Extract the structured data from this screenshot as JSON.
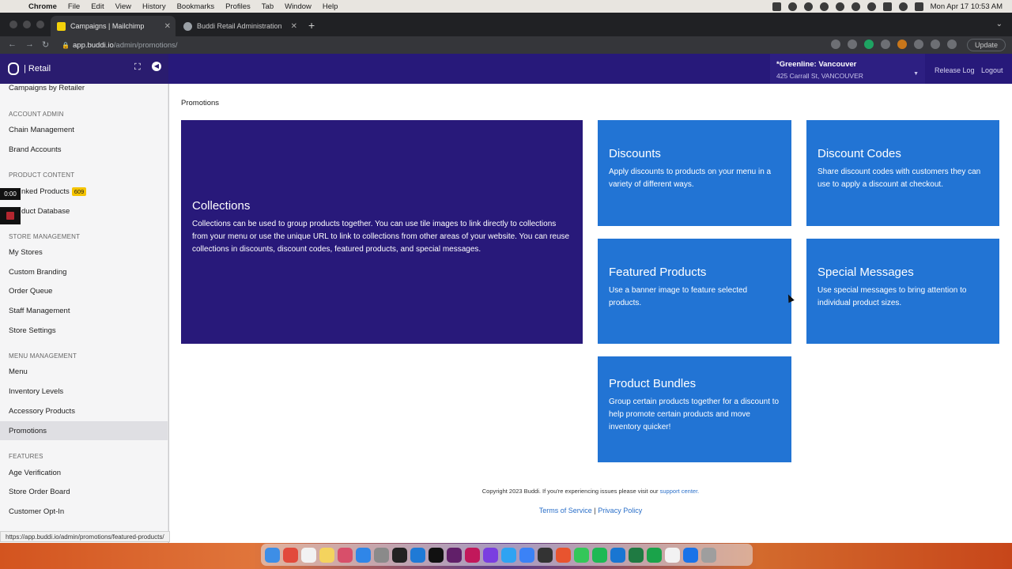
{
  "macbar": {
    "menus": [
      "Chrome",
      "File",
      "Edit",
      "View",
      "History",
      "Bookmarks",
      "Profiles",
      "Tab",
      "Window",
      "Help"
    ],
    "clock": "Mon Apr 17  10:53 AM"
  },
  "browser": {
    "tabs": [
      {
        "title": "Campaigns | Mailchimp",
        "active": true,
        "favicon_color": "#f4d20a"
      },
      {
        "title": "Buddi Retail Administration",
        "active": false,
        "favicon_color": "#9aa0a6"
      }
    ],
    "url_host": "app.buddi.io",
    "url_path": "/admin/promotions/",
    "update_label": "Update"
  },
  "header": {
    "brand": "| Retail",
    "store_name": "*Greenline: Vancouver",
    "store_address": "425 Carrall St, VANCOUVER",
    "release_log": "Release Log",
    "logout": "Logout"
  },
  "sidebar": {
    "campaigns_by_retailer": "Campaigns by Retailer",
    "account_admin": "ACCOUNT ADMIN",
    "chain_management": "Chain Management",
    "brand_accounts": "Brand Accounts",
    "product_content": "PRODUCT CONTENT",
    "linked_products": "nked Products",
    "linked_badge": "609",
    "product_database": "duct Database",
    "store_management": "STORE MANAGEMENT",
    "my_stores": "My Stores",
    "custom_branding": "Custom Branding",
    "order_queue": "Order Queue",
    "staff_management": "Staff Management",
    "store_settings": "Store Settings",
    "menu_management": "MENU MANAGEMENT",
    "menu": "Menu",
    "inventory_levels": "Inventory Levels",
    "accessory_products": "Accessory Products",
    "promotions": "Promotions",
    "features": "FEATURES",
    "age_verification": "Age Verification",
    "store_order_board": "Store Order Board",
    "customer_opt_in": "Customer Opt-In",
    "timer": "0:00"
  },
  "main": {
    "breadcrumb": "Promotions",
    "tiles": {
      "collections": {
        "title": "Collections",
        "desc": "Collections can be used to group products together. You can use tile images to link directly to collections from your menu or use the unique URL to link to collections from other areas of your website. You can reuse collections in discounts, discount codes, featured products, and special messages."
      },
      "discounts": {
        "title": "Discounts",
        "desc": "Apply discounts to products on your menu in a variety of different ways."
      },
      "discount_codes": {
        "title": "Discount Codes",
        "desc": "Share discount codes with customers they can use to apply a discount at checkout."
      },
      "featured_products": {
        "title": "Featured Products",
        "desc": "Use a banner image to feature selected products."
      },
      "special_messages": {
        "title": "Special Messages",
        "desc": "Use special messages to bring attention to individual product sizes."
      },
      "product_bundles": {
        "title": "Product Bundles",
        "desc": "Group certain products together for a discount to help promote certain products and move inventory quicker!"
      }
    },
    "footer_copy": "Copyright 2023 Buddi. If you're experiencing issues please visit our",
    "support_link": "support center.",
    "terms": "Terms of Service",
    "separator": "|",
    "privacy": "Privacy Policy"
  },
  "status_url": "https://app.buddi.io/admin/promotions/featured-products/",
  "colors": {
    "header": "#27197a",
    "collections_tile": "#28197a",
    "blue_tile": "#2274d4"
  }
}
